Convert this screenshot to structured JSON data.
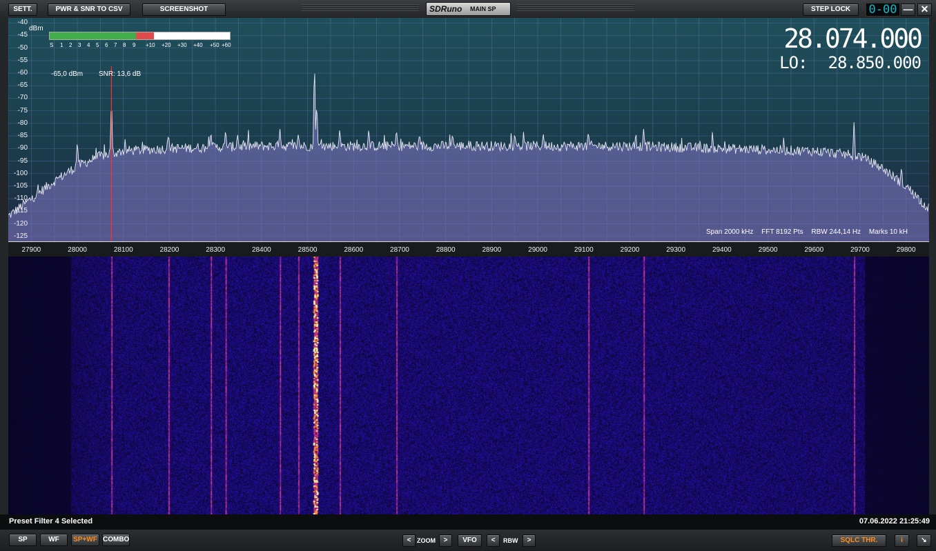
{
  "topbar": {
    "sett_label": "SETT.",
    "csv_label": "PWR & SNR TO CSV",
    "screenshot_label": "SCREENSHOT",
    "brand": "SDRuno",
    "window_title": "MAIN SP",
    "step_lock_label": "STEP LOCK",
    "clock": "0-00",
    "minimize_glyph": "—",
    "close_glyph": "✕"
  },
  "spectrum": {
    "unit": "dBm",
    "y_ticks": [
      "-40",
      "-45",
      "-50",
      "-55",
      "-60",
      "-65",
      "-70",
      "-75",
      "-80",
      "-85",
      "-90",
      "-95",
      "-100",
      "-105",
      "-110",
      "-115",
      "-120",
      "-125"
    ],
    "smeter_scale": [
      "S",
      "1",
      "2",
      "3",
      "4",
      "5",
      "6",
      "7",
      "8",
      "9",
      "+10",
      "+20",
      "+30",
      "+40",
      "+50",
      "+60"
    ],
    "smeter_green_fraction": 0.48,
    "smeter_red_fraction": 0.1,
    "power": "-65,0 dBm",
    "snr": "SNR: 13,6 dB",
    "frequency": "28.074.000",
    "lo_label": "LO:",
    "lo_value": "28.850.000",
    "info": {
      "span": "Span 2000 kHz",
      "fft": "FFT 8192 Pts",
      "rbw": "RBW 244,14 Hz",
      "marks": "Marks 10 kH"
    },
    "x_ticks": [
      "27900",
      "28000",
      "28100",
      "28200",
      "28300",
      "28400",
      "28500",
      "28600",
      "28700",
      "28800",
      "28900",
      "29000",
      "29100",
      "29200",
      "29300",
      "29400",
      "29500",
      "29600",
      "29700",
      "29800"
    ]
  },
  "chart_data": {
    "type": "line",
    "xlabel": "",
    "ylabel": "",
    "xlim": [
      27850,
      29850
    ],
    "ylim": [
      -127,
      -38
    ],
    "x_unit": "kHz",
    "y_unit": "dBm",
    "noise_floor": [
      [
        27850,
        -117
      ],
      [
        27900,
        -110
      ],
      [
        27950,
        -103
      ],
      [
        28000,
        -97
      ],
      [
        28050,
        -93
      ],
      [
        28100,
        -91
      ],
      [
        28200,
        -90
      ],
      [
        28400,
        -89
      ],
      [
        28600,
        -89
      ],
      [
        28800,
        -89
      ],
      [
        29000,
        -89
      ],
      [
        29200,
        -89
      ],
      [
        29400,
        -90
      ],
      [
        29600,
        -91
      ],
      [
        29700,
        -93
      ],
      [
        29750,
        -98
      ],
      [
        29800,
        -105
      ],
      [
        29850,
        -114
      ]
    ],
    "peaks": [
      [
        28074,
        -68
      ],
      [
        28000,
        -86
      ],
      [
        28198,
        -84
      ],
      [
        28290,
        -83
      ],
      [
        28322,
        -82
      ],
      [
        28348,
        -84
      ],
      [
        28440,
        -82
      ],
      [
        28480,
        -84
      ],
      [
        28515,
        -52
      ],
      [
        28520,
        -70
      ],
      [
        28570,
        -82
      ],
      [
        28633,
        -82
      ],
      [
        28693,
        -82
      ],
      [
        28815,
        -84
      ],
      [
        29012,
        -84
      ],
      [
        29110,
        -83
      ],
      [
        29230,
        -82
      ],
      [
        29687,
        -79
      ],
      [
        29790,
        -97
      ]
    ],
    "vfo_marker": 28074
  },
  "waterfall": {
    "signals": [
      28074,
      28198,
      28290,
      28322,
      28440,
      28480,
      28515,
      28520,
      28570,
      28693,
      29110,
      29230,
      29687
    ]
  },
  "status": {
    "message": "Preset Filter 4 Selected",
    "datetime": "07.06.2022 21:25:49"
  },
  "bottombar": {
    "sp": "SP",
    "wf": "WF",
    "spwf": "SP+WF",
    "combo": "COMBO",
    "zoom_prev": "<",
    "zoom_label": "ZOOM",
    "zoom_next": ">",
    "vfo": "VFO",
    "rbw_prev": "<",
    "rbw_label": "RBW",
    "rbw_next": ">",
    "sqlc": "SQLC THR.",
    "info": "i",
    "resize": "↘"
  },
  "colors": {
    "accent_orange": "#ff8c1a",
    "clock_cyan": "#19b7c9",
    "vfo_marker": "#ff3030"
  }
}
